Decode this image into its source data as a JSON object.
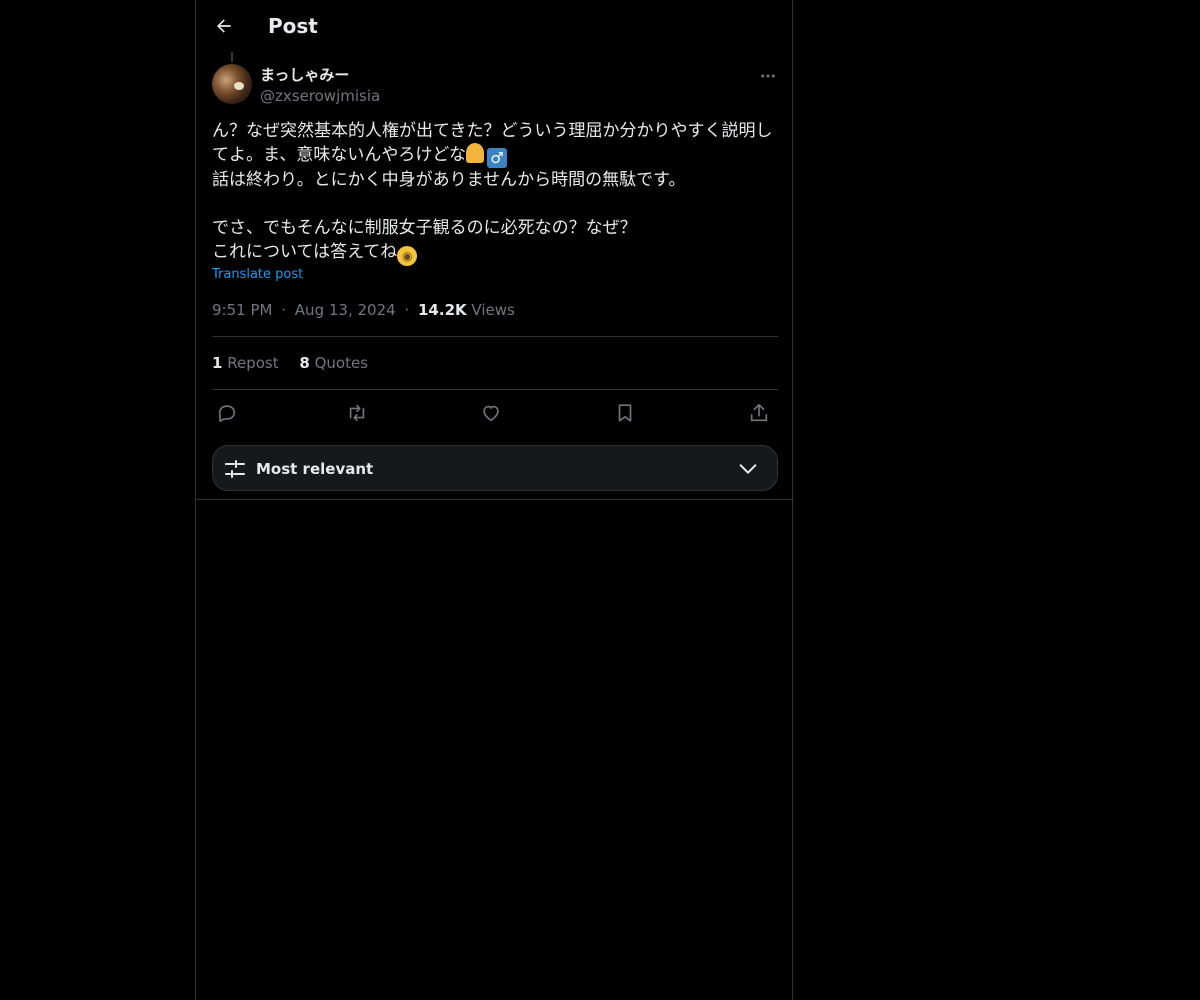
{
  "header": {
    "title": "Post",
    "back_icon": "arrow-left-icon"
  },
  "author": {
    "display_name": "まっしゃみー",
    "handle": "@zxserowjmisia",
    "avatar_icon": "avatar-photo"
  },
  "post": {
    "lines": [
      "ん？なぜ突然基本的人権が出てきた？どういう理屈か分かりやすく説明し",
      "てよ。ま、意味ないんやろけどな",
      "話は終わり。とにかく中身がありませんから時間の無駄です。",
      "",
      "でさ、でもそんなに制服女子観るのに必死なの？なぜ？",
      "これについては答えてね"
    ],
    "emojis": [
      "person-shrugging-emoji",
      "male-sign-emoji",
      "face-with-monocle-emoji"
    ],
    "translate_label": "Translate post"
  },
  "meta": {
    "time": "9:51 PM",
    "sep1": "·",
    "date": "Aug 13, 2024",
    "sep2": "·",
    "views_count": "14.2K",
    "views_label": "Views"
  },
  "stats": {
    "reposts_count": "1",
    "reposts_label": "Repost",
    "quotes_count": "8",
    "quotes_label": "Quotes"
  },
  "actions": [
    "reply-icon",
    "repost-icon",
    "like-icon",
    "bookmark-icon",
    "share-icon"
  ],
  "sort": {
    "label": "Most relevant",
    "icon": "sliders-icon",
    "chevron": "chevron-down-icon"
  },
  "colors": {
    "background": "#000000",
    "text": "#e7e9ea",
    "secondary": "#71767b",
    "accent": "#1d9bf0",
    "border": "#2f3336"
  }
}
